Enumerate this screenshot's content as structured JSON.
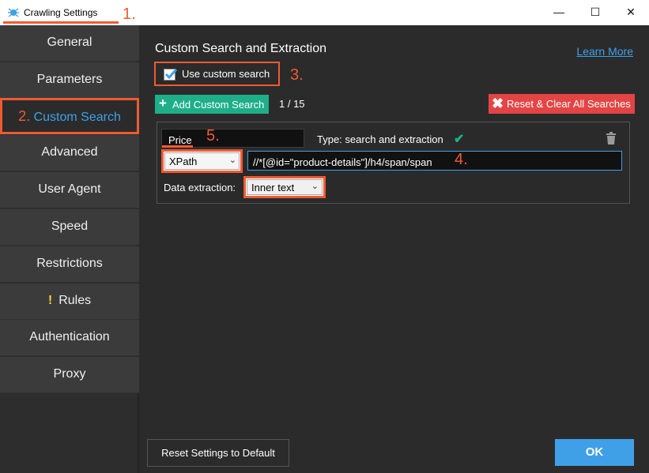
{
  "window": {
    "title": "Crawling Settings",
    "minimize_glyph": "—",
    "maximize_glyph": "☐",
    "close_glyph": "✕"
  },
  "annotations": {
    "a1": "1.",
    "a2": "2.",
    "a3": "3.",
    "a4": "4.",
    "a5": "5."
  },
  "sidebar": {
    "items": [
      {
        "label": "General"
      },
      {
        "label": "Parameters"
      },
      {
        "label": "Custom Search"
      },
      {
        "label": "Advanced"
      },
      {
        "label": "User Agent"
      },
      {
        "label": "Speed"
      },
      {
        "label": "Restrictions"
      },
      {
        "label": "Rules",
        "warning": "!"
      },
      {
        "label": "Authentication"
      },
      {
        "label": "Proxy"
      }
    ],
    "active_item": "Custom Search"
  },
  "main": {
    "heading": "Custom Search and Extraction",
    "learn_more": "Learn More",
    "use_custom_search": {
      "label": "Use custom search",
      "checked": true
    },
    "add_button": "Add Custom Search",
    "count": "1 / 15",
    "reset_all_button": "Reset & Clear All Searches",
    "search": {
      "name": "Price",
      "type_label": "Type: search and extraction",
      "method": "XPath",
      "expression": "//*[@id=\"product-details\"]/h4/span/span",
      "extraction_label": "Data extraction:",
      "extraction_value": "Inner text"
    }
  },
  "footer": {
    "reset_default": "Reset Settings to Default",
    "ok": "OK"
  },
  "colors": {
    "accent": "#3fa0e8",
    "annotation": "#f05a32",
    "add_green": "#1fae8a",
    "reset_red": "#e34545",
    "warning": "#f5d142"
  }
}
